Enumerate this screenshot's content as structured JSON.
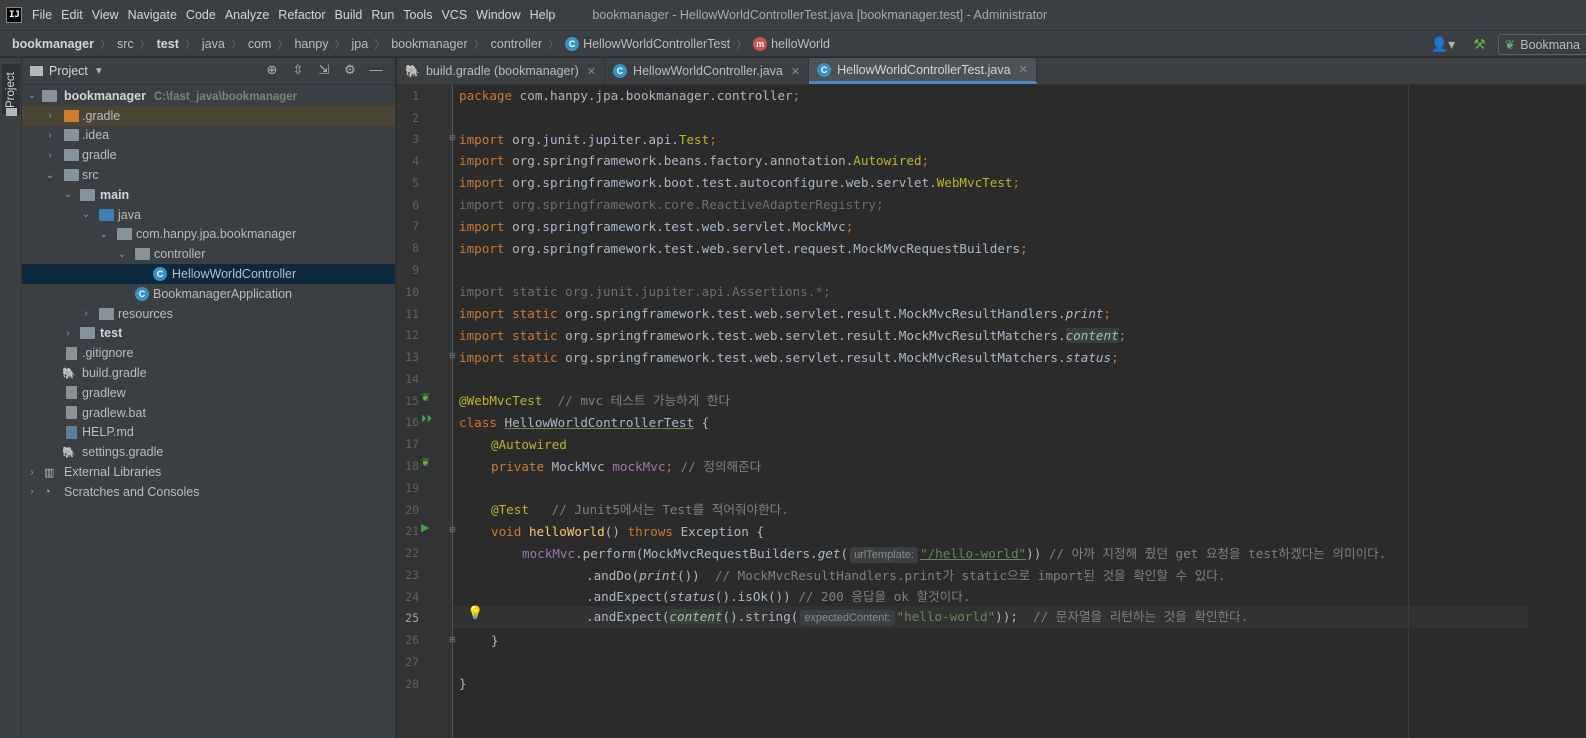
{
  "menubar": {
    "app_icon": "IJ",
    "items": [
      "File",
      "Edit",
      "View",
      "Navigate",
      "Code",
      "Analyze",
      "Refactor",
      "Build",
      "Run",
      "Tools",
      "VCS",
      "Window",
      "Help"
    ],
    "window_title": "bookmanager - HellowWorldControllerTest.java [bookmanager.test] - Administrator"
  },
  "breadcrumb": [
    "bookmanager",
    "src",
    "test",
    "java",
    "com",
    "hanpy",
    "jpa",
    "bookmanager",
    "controller",
    "HellowWorldControllerTest",
    "helloWorld"
  ],
  "toolbar": {
    "run_config_label": "Bookmana"
  },
  "project": {
    "title": "Project",
    "stripe_label": "Project",
    "tree": [
      {
        "label": "bookmanager",
        "hint": "C:\\fast_java\\bookmanager"
      },
      {
        "label": ".gradle"
      },
      {
        "label": ".idea"
      },
      {
        "label": "gradle"
      },
      {
        "label": "src"
      },
      {
        "label": "main"
      },
      {
        "label": "java"
      },
      {
        "label": "com.hanpy.jpa.bookmanager"
      },
      {
        "label": "controller"
      },
      {
        "label": "HellowWorldController"
      },
      {
        "label": "BookmanagerApplication"
      },
      {
        "label": "resources"
      },
      {
        "label": "test"
      },
      {
        "label": ".gitignore"
      },
      {
        "label": "build.gradle"
      },
      {
        "label": "gradlew"
      },
      {
        "label": "gradlew.bat"
      },
      {
        "label": "HELP.md"
      },
      {
        "label": "settings.gradle"
      },
      {
        "label": "External Libraries"
      },
      {
        "label": "Scratches and Consoles"
      }
    ]
  },
  "editor_tabs": [
    {
      "label": "build.gradle (bookmanager)"
    },
    {
      "label": "HellowWorldController.java"
    },
    {
      "label": "HellowWorldControllerTest.java"
    }
  ],
  "line_numbers": [
    "1",
    "2",
    "3",
    "4",
    "5",
    "6",
    "7",
    "8",
    "9",
    "10",
    "11",
    "12",
    "13",
    "14",
    "15",
    "16",
    "17",
    "18",
    "19",
    "20",
    "21",
    "22",
    "23",
    "24",
    "25",
    "26",
    "27",
    "28"
  ],
  "code": {
    "l1_kw": "package",
    "l1_rest": " com.hanpy.jpa.bookmanager.controller",
    "semi": ";",
    "import": "import",
    "static": "static",
    "l3": " org.junit.jupiter.api.",
    "l3_cls": "Test",
    "l4": " org.springframework.beans.factory.annotation.",
    "l4_cls": "Autowired",
    "l5": " org.springframework.boot.test.autoconfigure.web.servlet.",
    "l5_cls": "WebMvcTest",
    "l6": "import org.springframework.core.ReactiveAdapterRegistry;",
    "l7": " org.springframework.test.web.servlet.MockMvc",
    "l8": " org.springframework.test.web.servlet.request.MockMvcRequestBuilders",
    "l10": "import static org.junit.jupiter.api.Assertions.*;",
    "l11": " org.springframework.test.web.servlet.result.MockMvcResultHandlers.",
    "l11_m": "print",
    "l12": " org.springframework.test.web.servlet.result.MockMvcResultMatchers.",
    "l12_m": "content",
    "l13": " org.springframework.test.web.servlet.result.MockMvcResultMatchers.",
    "l13_m": "status",
    "l15_ann": "@WebMvcTest",
    "l15_cmt": "  // mvc 테스트 가능하게 한다",
    "l16_kw": "class",
    "l16_name": "HellowWorldControllerTest",
    "l16_rest": " {",
    "l17_ann": "@Autowired",
    "l18_kw": "private",
    "l18_type": " MockMvc ",
    "l18_field": "mockMvc",
    "l18_cmt": " // 정의해준다",
    "l20_ann": "@Test",
    "l20_cmt": "   // Junit5에서는 Test를 적어줘야한다.",
    "l21_kw": "void",
    "l21_fn": "helloWorld",
    "l21_mid": "() ",
    "l21_kw2": "throws",
    "l21_rest": " Exception {",
    "l22_field": "mockMvc",
    "l22_a": ".perform(MockMvcRequestBuilders.",
    "l22_get": "get",
    "l22_b": "(",
    "l22_hint": "urlTemplate:",
    "l22_str": "\"/hello-world\"",
    "l22_c": ")) ",
    "l22_cmt": "// 아까 지정해 줬던 get 요청을 test하겠다는 의미이다.",
    "l23_a": ".andDo(",
    "l23_m": "print",
    "l23_b": "())  ",
    "l23_cmt": "// MockMvcResultHandlers.print가 static으로 import된 것을 확인할 수 있다.",
    "l24_a": ".andExpect(",
    "l24_m": "status",
    "l24_b": "().isOk()) ",
    "l24_cmt": "// 200 응답을 ok 할것이다.",
    "l25_a": ".andExpect(",
    "l25_m": "content",
    "l25_b": "().string(",
    "l25_hint": "expectedContent:",
    "l25_str": "\"hello-world\"",
    "l25_c": "));",
    "l25_cmt": "  // 문자열을 리턴하는 것을 확인한다.",
    "l26": "}",
    "l28": "}"
  },
  "colors": {
    "keyword": "#cc7832",
    "annotation": "#bbb529",
    "comment": "#808080",
    "string": "#6a8759",
    "function": "#ffc66d",
    "field": "#9876aa",
    "text": "#a9b7c6",
    "background": "#2b2b2b",
    "panel": "#3c3f41",
    "selection": "#0d293e",
    "accent": "#4a88c7"
  }
}
